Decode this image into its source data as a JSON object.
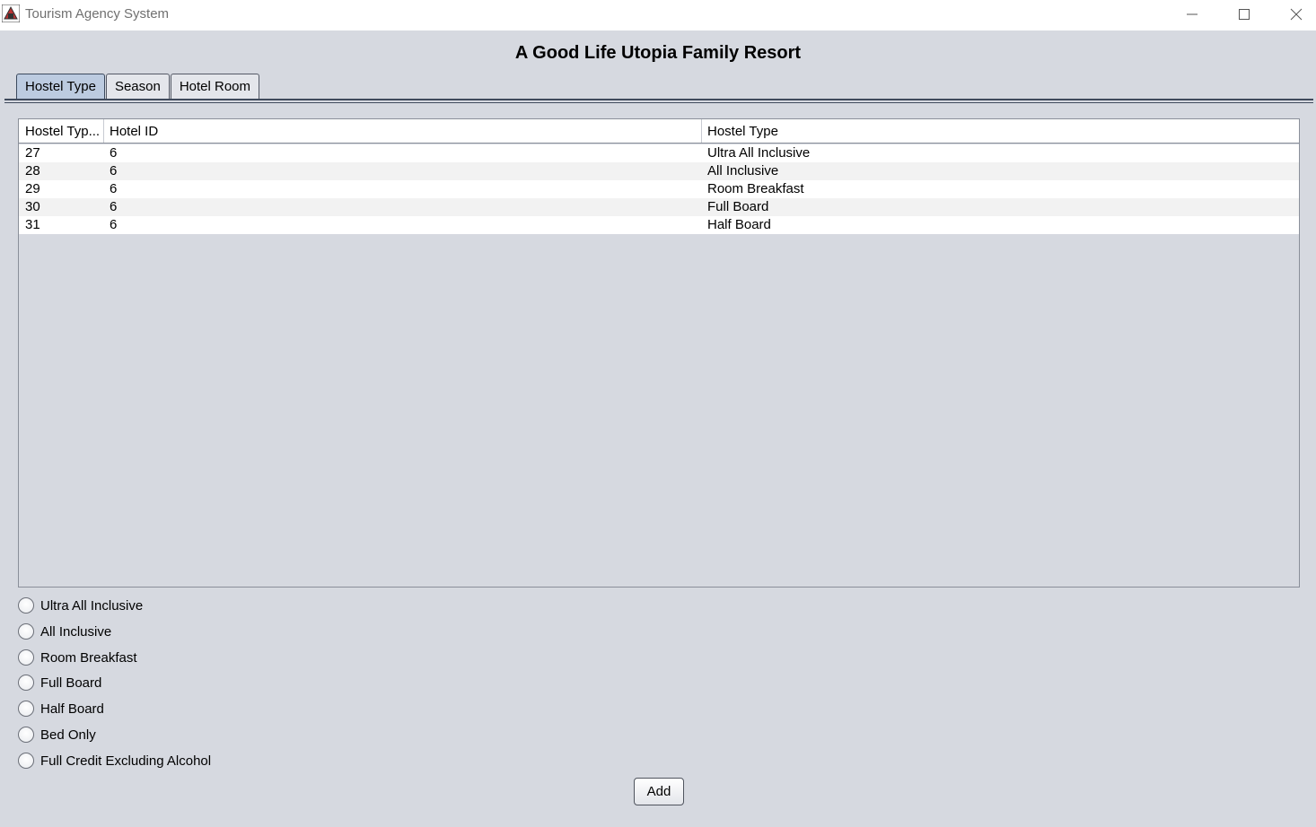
{
  "window": {
    "title": "Tourism Agency System",
    "icon": "java-app-icon",
    "controls": [
      "minimize-icon",
      "maximize-icon",
      "close-icon"
    ]
  },
  "heading": "A Good Life Utopia Family Resort",
  "tabs": [
    {
      "label": "Hostel Type",
      "active": true
    },
    {
      "label": "Season",
      "active": false
    },
    {
      "label": "Hotel Room",
      "active": false
    }
  ],
  "table": {
    "columns": [
      "Hostel Typ...",
      "Hotel ID",
      "Hostel Type"
    ],
    "rows": [
      [
        "27",
        "6",
        "Ultra All Inclusive"
      ],
      [
        "28",
        "6",
        "All Inclusive"
      ],
      [
        "29",
        "6",
        "Room Breakfast"
      ],
      [
        "30",
        "6",
        "Full Board"
      ],
      [
        "31",
        "6",
        "Half Board"
      ]
    ]
  },
  "options": [
    "Ultra All Inclusive",
    "All Inclusive",
    "Room Breakfast",
    "Full Board",
    "Half Board",
    "Bed Only",
    "Full Credit Excluding Alcohol"
  ],
  "add_label": "Add"
}
